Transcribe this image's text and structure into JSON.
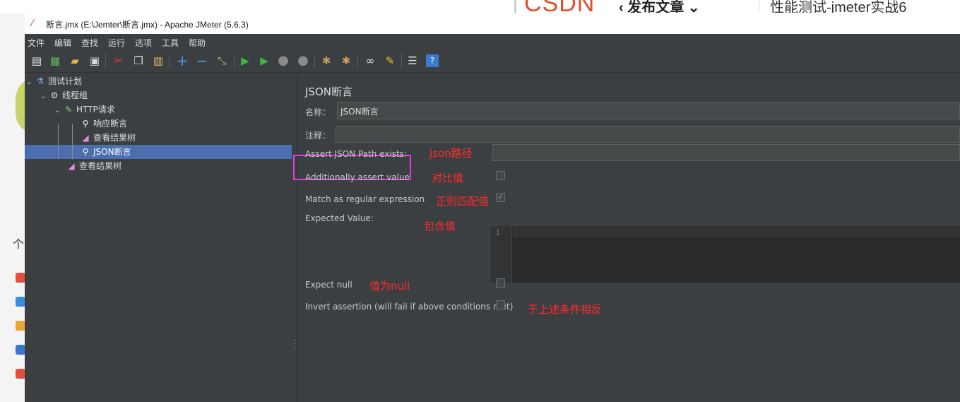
{
  "background": {
    "csdn_logo": "CSDN",
    "publish_label": "发布文章",
    "article_title": "性能测试-jmeter实战6",
    "side_char": "个"
  },
  "window": {
    "title": "断言.jmx (E:\\Jemter\\断言.jmx) - Apache JMeter (5.6.3)"
  },
  "menu": [
    "文件",
    "编辑",
    "查找",
    "运行",
    "选项",
    "工具",
    "帮助"
  ],
  "toolbar_icons": [
    "new-icon",
    "templates-icon",
    "open-icon",
    "save-icon",
    "cut-icon",
    "copy-icon",
    "paste-icon",
    "expand-icon",
    "collapse-icon",
    "toggle-icon",
    "start-icon",
    "start-no-pause-icon",
    "stop-icon",
    "shutdown-icon",
    "clear-icon",
    "clear-all-icon",
    "search-icon",
    "reset-search-icon",
    "function-helper-icon",
    "help-icon"
  ],
  "tree": {
    "items": [
      {
        "label": "测试计划",
        "icon": "flask-icon"
      },
      {
        "label": "线程组",
        "icon": "gear-icon"
      },
      {
        "label": "HTTP请求",
        "icon": "pipette-icon"
      },
      {
        "label": "响应断言",
        "icon": "magnifier-icon"
      },
      {
        "label": "查看结果树",
        "icon": "chart-icon"
      },
      {
        "label": "JSON断言",
        "icon": "magnifier-icon",
        "selected": true
      },
      {
        "label": "查看结果树",
        "icon": "chart-icon"
      }
    ]
  },
  "panel": {
    "title": "JSON断言",
    "name_label": "名称：",
    "name_value": "JSON断言",
    "comment_label": "注释：",
    "comment_value": "",
    "json_path_label": "Assert JSON Path exists:",
    "json_path_value": "",
    "additionally_label": "Additionally assert value",
    "additionally_checked": false,
    "regex_label": "Match as regular expression",
    "regex_checked": true,
    "expected_label": "Expected Value:",
    "editor_line": "1",
    "expect_null_label": "Expect null",
    "expect_null_checked": false,
    "invert_label": "Invert assertion (will fail if above conditions met)",
    "invert_checked": false
  },
  "annotations": {
    "json_path": "json路径",
    "compare": "对比值",
    "regex": "正则匹配值",
    "contains": "包含值",
    "null": "值为null",
    "invert": "于上述条件相反"
  },
  "colors": {
    "panel_bg": "#3c3f41",
    "selection": "#4b6eaf",
    "annotation": "#ff2b2b",
    "highlight_box": "#e33be6"
  }
}
